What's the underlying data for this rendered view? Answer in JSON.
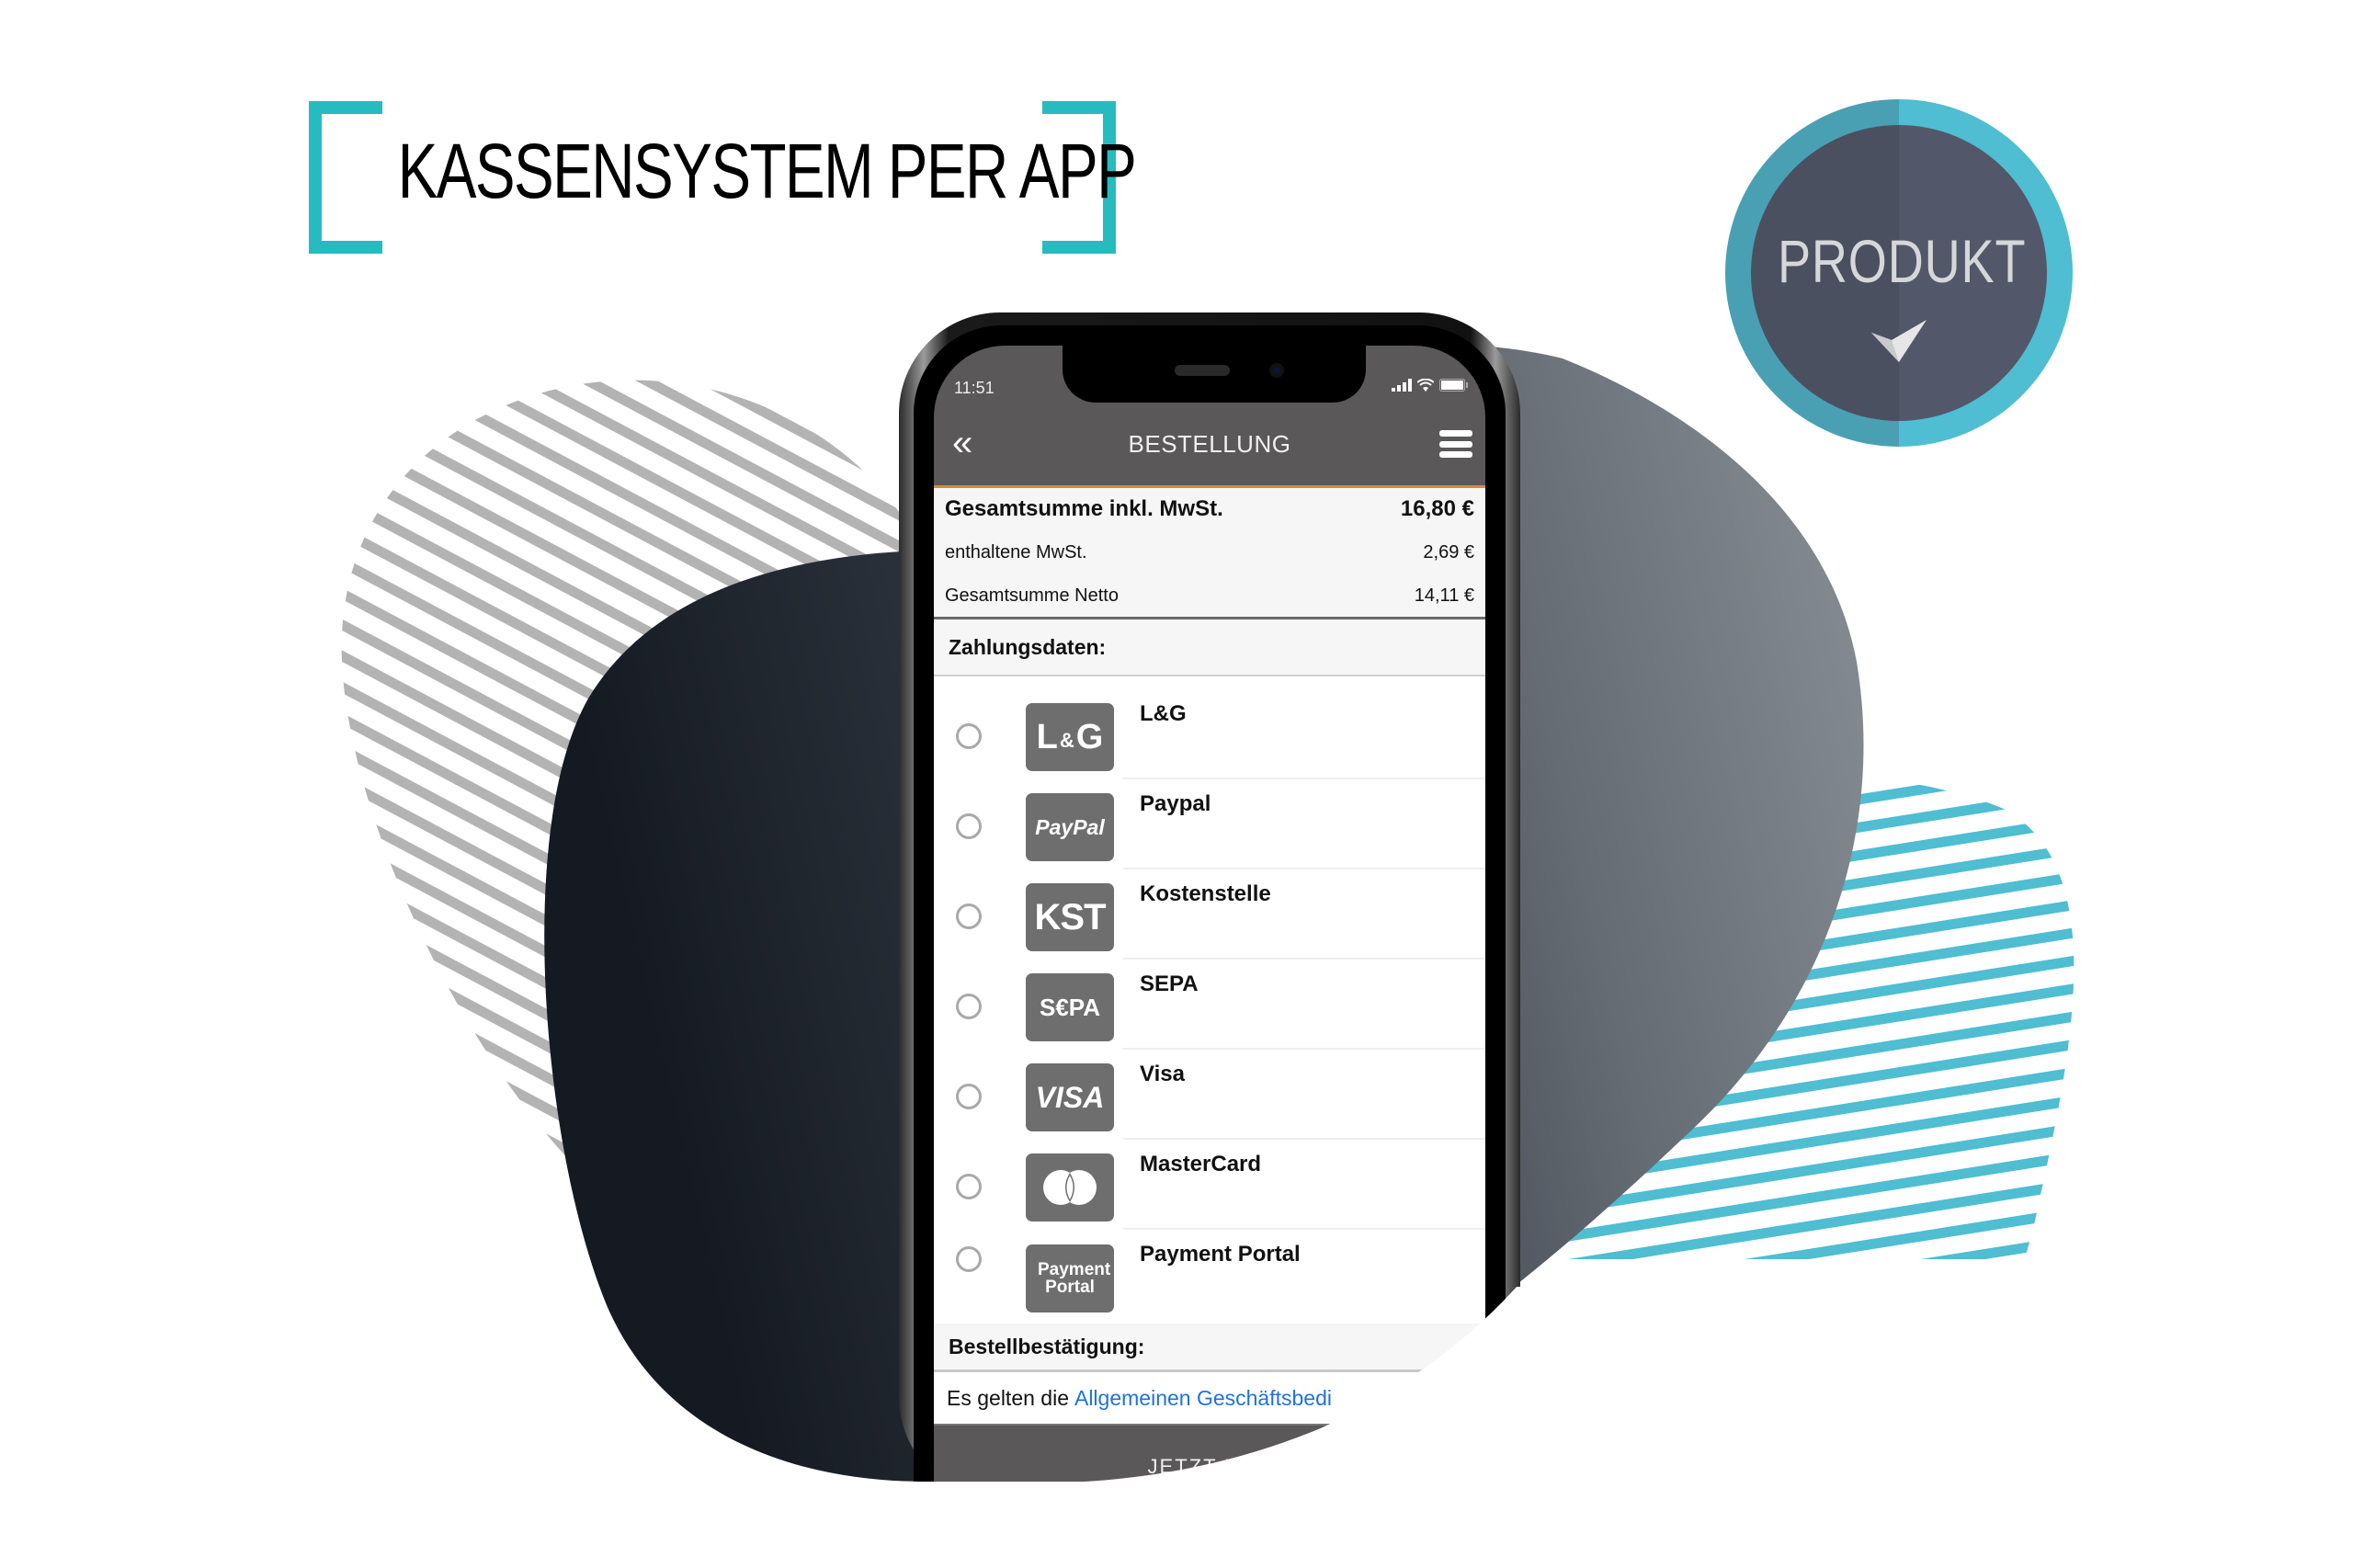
{
  "headline": {
    "title": "KASSENSYSTEM PER APP",
    "bracket_color": "#26bcbf"
  },
  "badge": {
    "label": "PRODUKT",
    "icon": "checkmark-icon",
    "ring_color": "#4fbdd2",
    "fill_color": "#4f5566"
  },
  "decor": {
    "stripes_left_color": "#b3b3b3",
    "stripes_right_color": "#4fbdd2",
    "blob_dark": "#1b2029",
    "blob_light": "#858b91"
  },
  "phone": {
    "status": {
      "time": "11:51",
      "icons": [
        "signal-icon",
        "wifi-icon",
        "battery-icon"
      ]
    },
    "nav": {
      "title": "BESTELLUNG",
      "back_icon": "double-chevron-left-icon",
      "menu_icon": "hamburger-menu-icon"
    },
    "summary": [
      {
        "label": "Gesamtsumme inkl. MwSt.",
        "value": "16,80 €",
        "bold": true
      },
      {
        "label": "enthaltene MwSt.",
        "value": "2,69 €",
        "bold": false
      },
      {
        "label": "Gesamtsumme Netto",
        "value": "14,11 €",
        "bold": false
      }
    ],
    "payment_heading": "Zahlungsdaten:",
    "payment_methods": [
      {
        "label": "L&G",
        "logo": "L&G",
        "selected": false
      },
      {
        "label": "Paypal",
        "logo": "PayPal",
        "selected": false
      },
      {
        "label": "Kostenstelle",
        "logo": "KST",
        "selected": false
      },
      {
        "label": "SEPA",
        "logo": "S€PA",
        "selected": false
      },
      {
        "label": "Visa",
        "logo": "VISA",
        "selected": false
      },
      {
        "label": "MasterCard",
        "logo": "mastercard-icon",
        "selected": false
      },
      {
        "label": "Payment Portal",
        "logo": "Payment Portal",
        "selected": false
      }
    ],
    "confirmation_heading": "Bestellbestätigung:",
    "terms_prefix": "Es gelten die",
    "terms_link": "Allgemeinen Geschäftsbedi",
    "buy_button": "JETZT KAU"
  }
}
